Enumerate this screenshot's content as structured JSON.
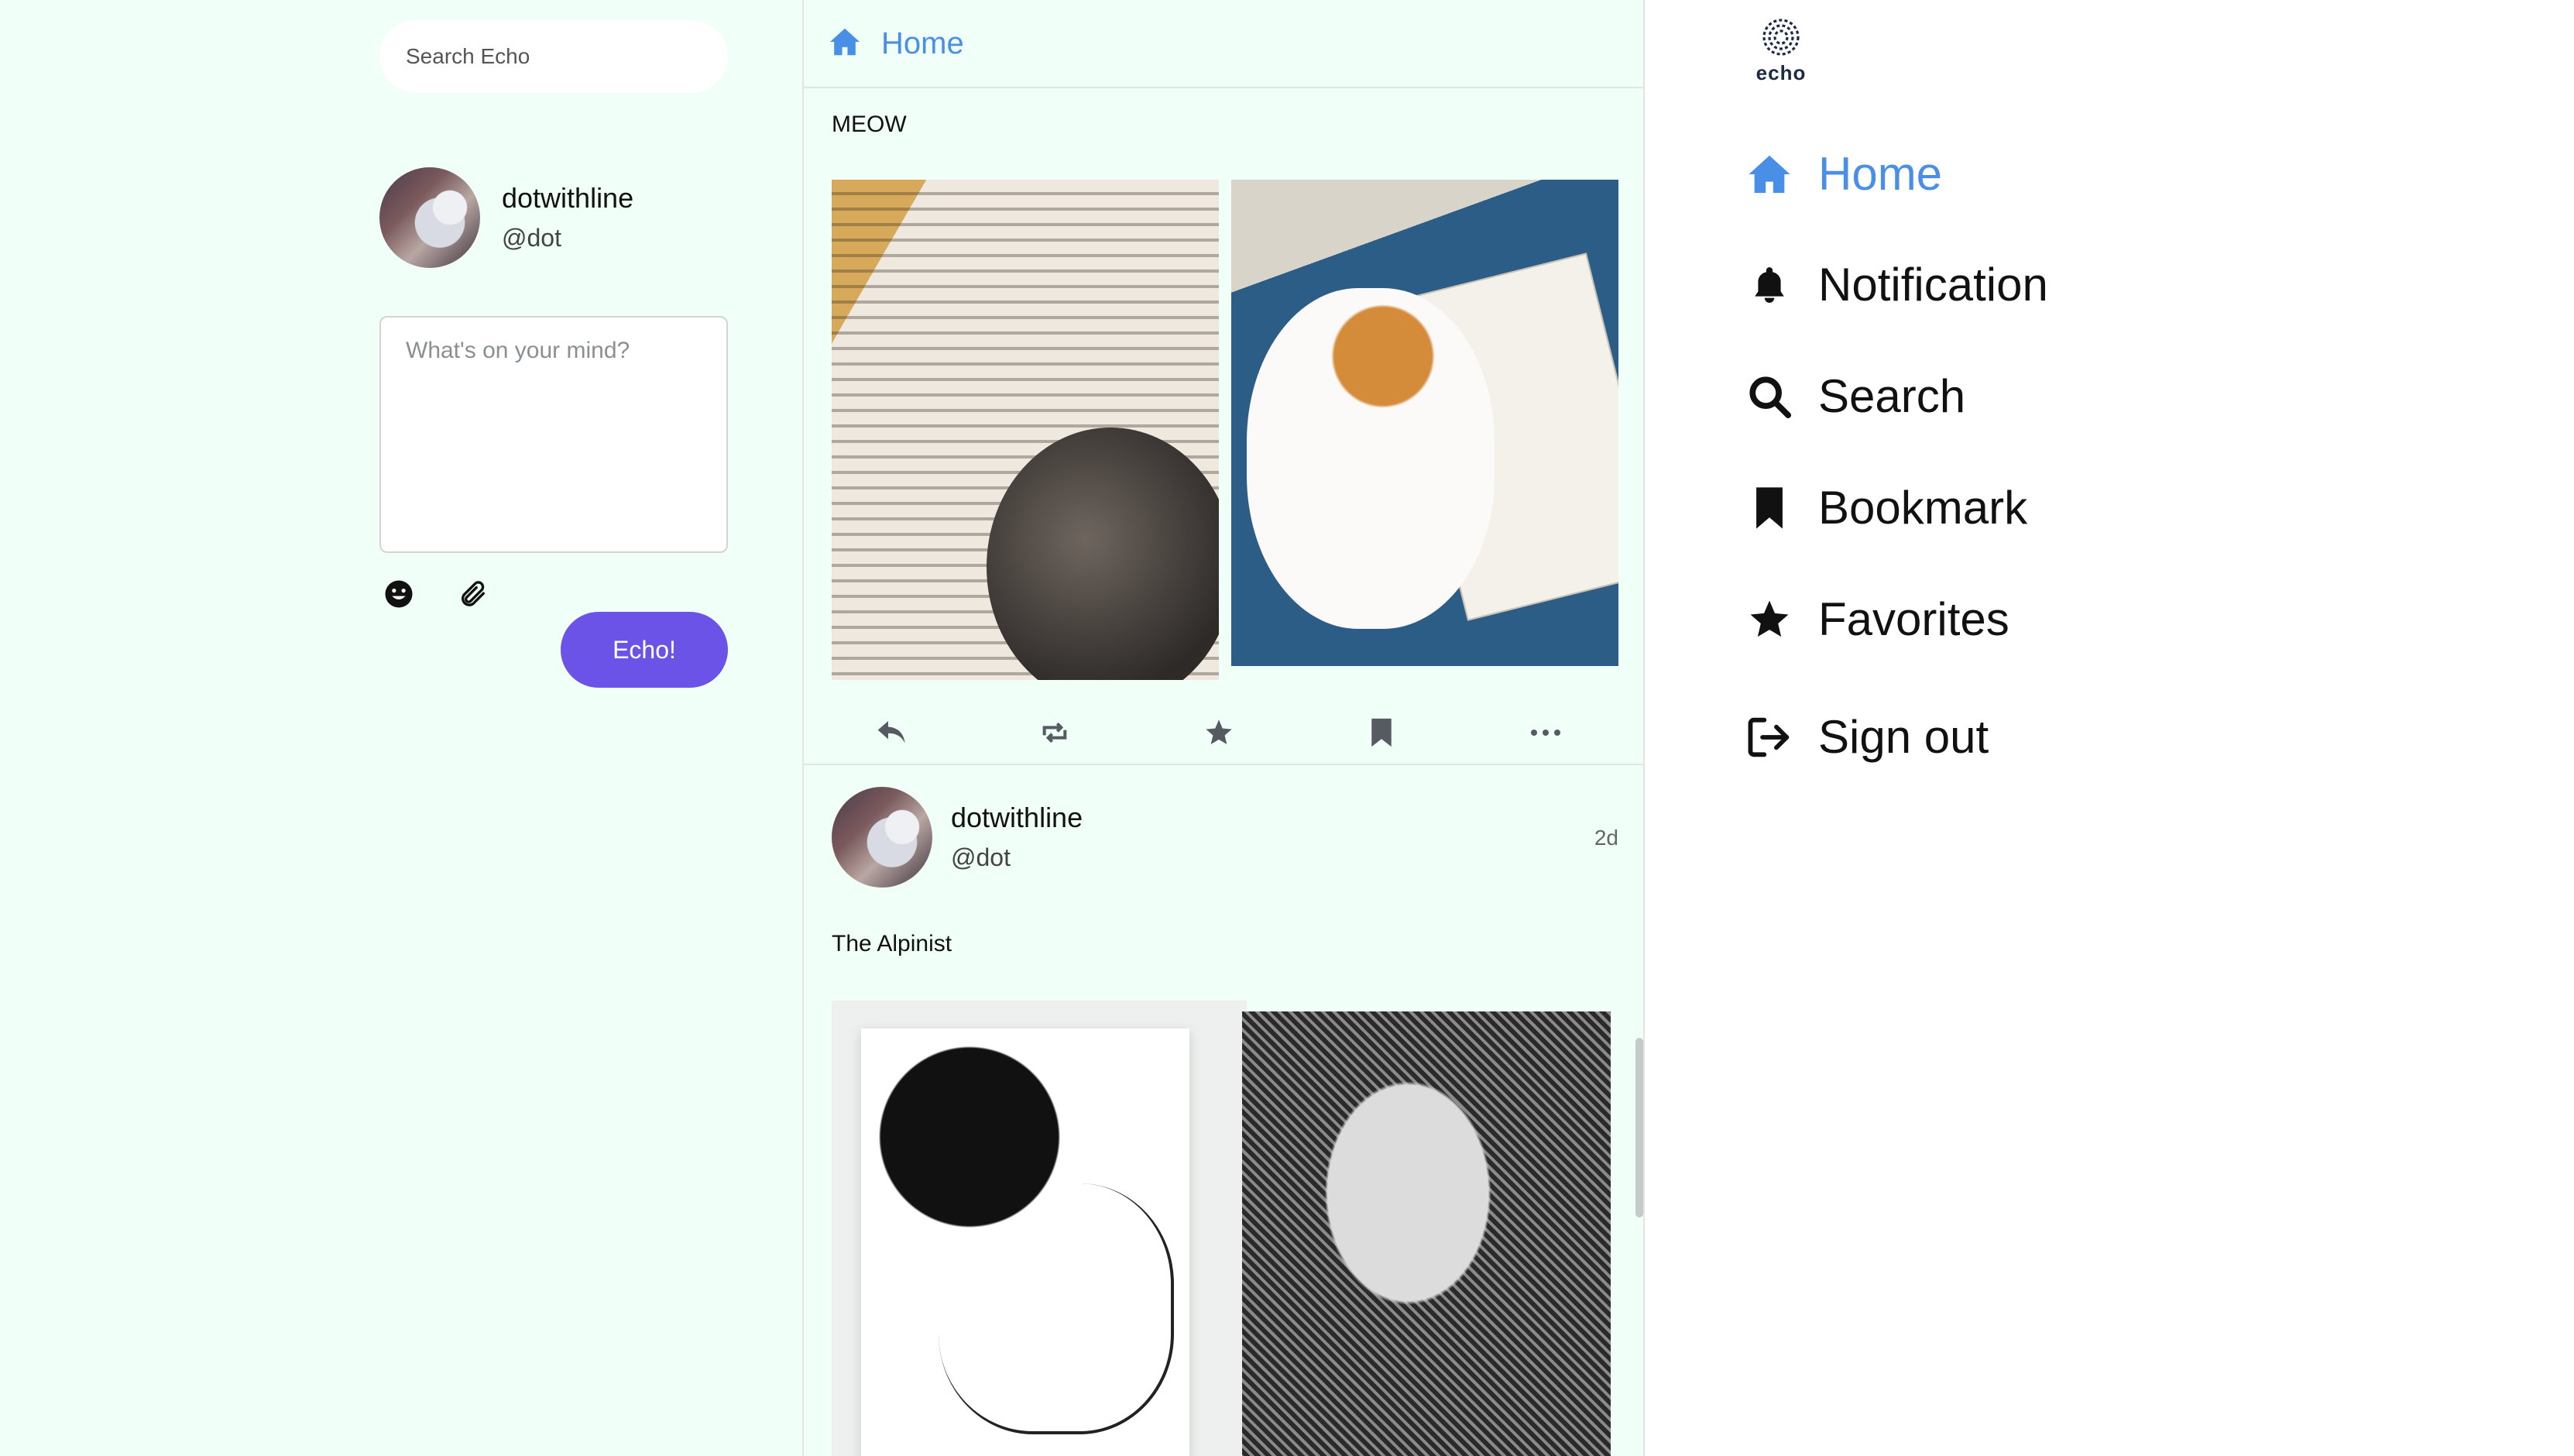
{
  "search": {
    "placeholder": "Search Echo"
  },
  "user": {
    "display_name": "dotwithline",
    "handle": "@dot"
  },
  "composer": {
    "placeholder": "What's on your mind?",
    "submit_label": "Echo!"
  },
  "feed": {
    "header_title": "Home",
    "posts": [
      {
        "text": "MEOW"
      },
      {
        "author": "dotwithline",
        "handle": "@dot",
        "time": "2d",
        "text": "The Alpinist"
      }
    ]
  },
  "nav": {
    "logo_text": "echo",
    "items": [
      {
        "label": "Home",
        "icon": "home-icon",
        "active": true
      },
      {
        "label": "Notification",
        "icon": "bell-icon"
      },
      {
        "label": "Search",
        "icon": "search-icon"
      },
      {
        "label": "Bookmark",
        "icon": "bookmark-icon"
      },
      {
        "label": "Favorites",
        "icon": "star-icon"
      },
      {
        "label": "Sign out",
        "icon": "sign-out-icon"
      }
    ]
  },
  "colors": {
    "accent": "#4a8fe7",
    "button": "#6a53e6",
    "background": "#f0fff8"
  }
}
